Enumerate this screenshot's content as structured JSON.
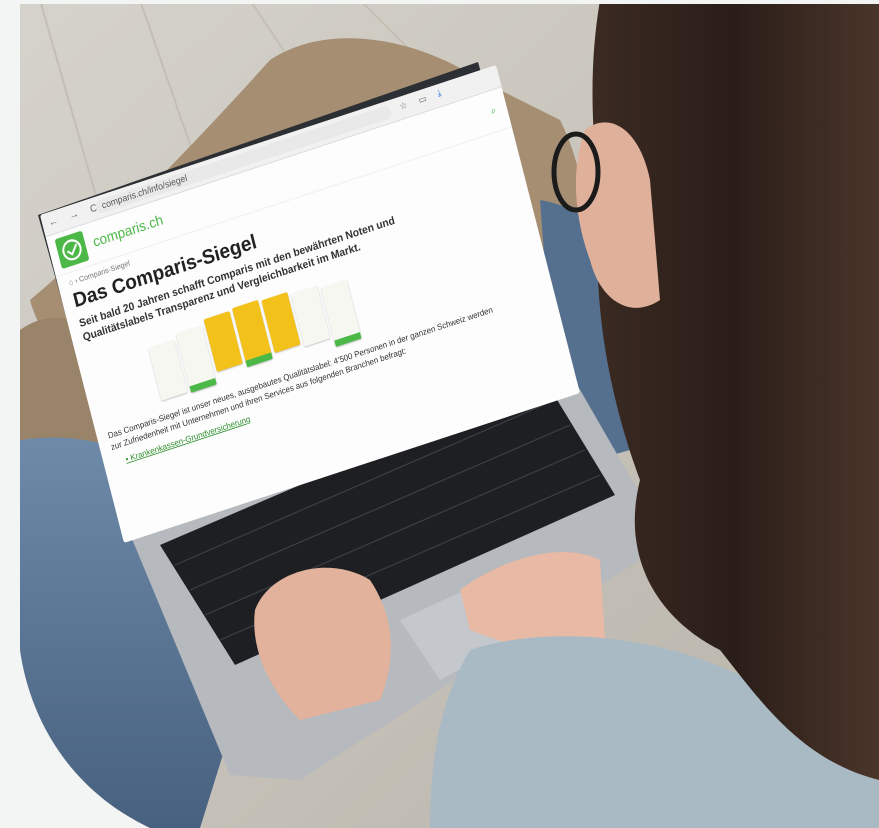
{
  "browser": {
    "nav_glyphs": "← → C",
    "url": "comparis.ch/info/siegel",
    "toolbar_icons": [
      "star-icon",
      "tab-icon",
      "download-icon"
    ]
  },
  "site": {
    "logo_text": "comparis.ch",
    "breadcrumb": "⌂ › Comparis-Siegel",
    "heading": "Das Comparis-Siegel",
    "lead": "Seit bald 20 Jahren schafft Comparis mit den bewährten Noten und Qualitätslabels Transparenz und Vergleichbarkeit im Markt.",
    "body": "Das Comparis-Siegel ist unser neues, ausgebautes Qualitätslabel: 4’500 Personen in der ganzen Schweiz werden zur Zufriedenheit mit Unternehmen und ihren Services aus folgenden Branchen befragt:",
    "list_link": "Krankenkassen-Grundversicherung"
  },
  "colors": {
    "brand_green": "#4cb848",
    "label_yellow": "#f2c21b",
    "label_white": "#f7f7f2"
  }
}
